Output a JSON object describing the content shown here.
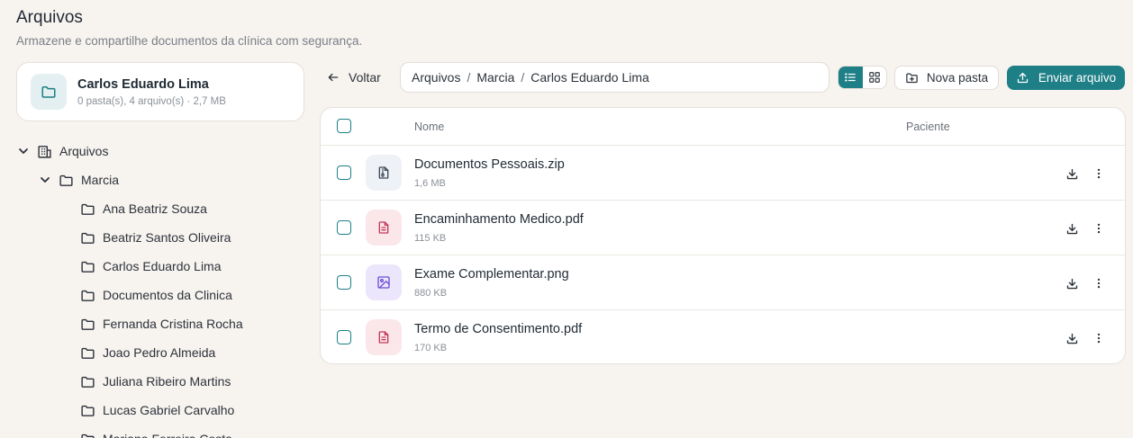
{
  "header": {
    "title": "Arquivos",
    "subtitle": "Armazene e compartilhe documentos da clínica com segurança."
  },
  "current_folder": {
    "name": "Carlos Eduardo Lima",
    "meta": "0 pasta(s), 4 arquivo(s) · 2,7 MB",
    "icon": "folder-icon"
  },
  "tree": {
    "root": "Arquivos",
    "level1": "Marcia",
    "children": [
      "Ana Beatriz Souza",
      "Beatriz Santos Oliveira",
      "Carlos Eduardo Lima",
      "Documentos da Clinica",
      "Fernanda Cristina Rocha",
      "Joao Pedro Almeida",
      "Juliana Ribeiro Martins",
      "Lucas Gabriel Carvalho",
      "Mariana Ferreira Costa"
    ]
  },
  "toolbar": {
    "back_label": "Voltar",
    "breadcrumb": [
      "Arquivos",
      "Marcia",
      "Carlos Eduardo Lima"
    ],
    "view_mode": "list",
    "new_folder_label": "Nova pasta",
    "upload_label": "Enviar arquivo"
  },
  "table": {
    "col_name": "Nome",
    "col_patient": "Paciente",
    "files": [
      {
        "name": "Documentos Pessoais.zip",
        "size": "1,6 MB",
        "type": "zip",
        "icon": "zip-file-icon"
      },
      {
        "name": "Encaminhamento Medico.pdf",
        "size": "115 KB",
        "type": "pdf",
        "icon": "pdf-file-icon"
      },
      {
        "name": "Exame Complementar.png",
        "size": "880 KB",
        "type": "image",
        "icon": "image-file-icon"
      },
      {
        "name": "Termo de Consentimento.pdf",
        "size": "170 KB",
        "type": "pdf",
        "icon": "pdf-file-icon"
      }
    ]
  },
  "colors": {
    "accent": "#1e7f86",
    "background": "#f7f3ef",
    "pdf": "#c2385b",
    "image": "#6d4ed6",
    "zip": "#3f4a59"
  }
}
